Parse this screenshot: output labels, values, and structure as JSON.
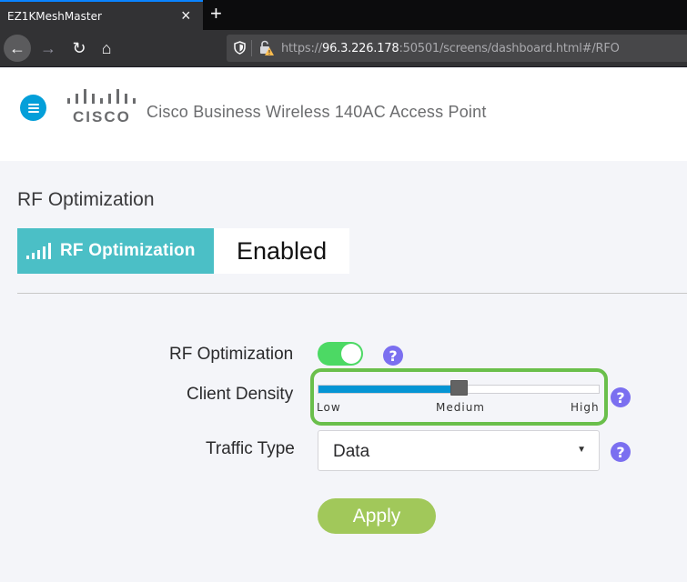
{
  "browser": {
    "tab_title": "EZ1KMeshMaster",
    "tab_close_glyph": "×",
    "new_tab_glyph": "+",
    "url_host": "96.3.226.178",
    "url_prefix": "https://",
    "url_rest": ":50501/screens/dashboard.html#/RFO",
    "back_glyph": "←",
    "forward_glyph": "→",
    "reload_glyph": "↻",
    "home_glyph": "⌂"
  },
  "header": {
    "logo_text": "cisco",
    "title": "Cisco Business Wireless 140AC Access Point",
    "accent_color": "#049fd9"
  },
  "page": {
    "title": "RF Optimization",
    "status_card": {
      "label": "RF Optimization",
      "value": "Enabled",
      "color": "#4bbfc6"
    }
  },
  "form": {
    "rf_optimization": {
      "label": "RF Optimization",
      "enabled": true,
      "help_glyph": "?"
    },
    "client_density": {
      "label": "Client Density",
      "ticks": [
        "Low",
        "Medium",
        "High"
      ],
      "selected": "Medium",
      "value_fraction": 0.5,
      "help_glyph": "?"
    },
    "traffic_type": {
      "label": "Traffic Type",
      "selected": "Data",
      "caret_glyph": "▼",
      "help_glyph": "?"
    },
    "apply_label": "Apply"
  }
}
